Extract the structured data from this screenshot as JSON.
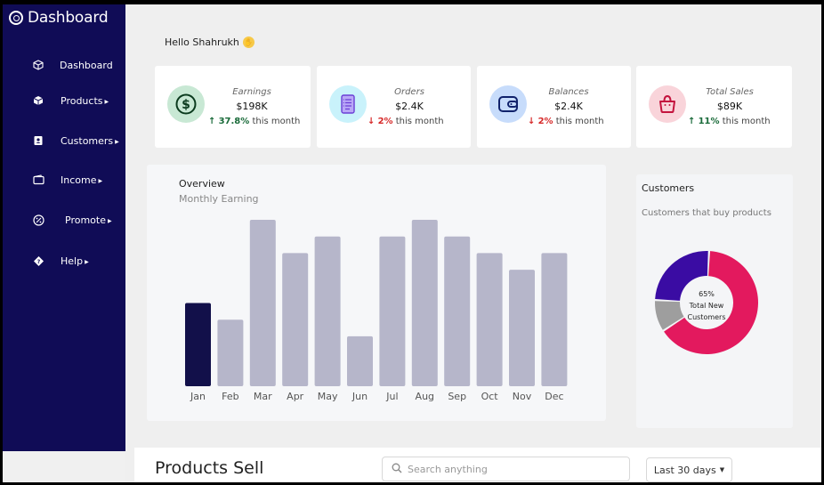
{
  "sidebar": {
    "brand": "Dashboard",
    "items": [
      {
        "label": "Dashboard",
        "icon": "cube-icon",
        "caret": false
      },
      {
        "label": "Products",
        "icon": "box-icon",
        "caret": true
      },
      {
        "label": "Customers",
        "icon": "id-card-icon",
        "caret": true
      },
      {
        "label": "Income",
        "icon": "wallet-icon",
        "caret": true
      },
      {
        "label": "Promote",
        "icon": "percent-icon",
        "caret": true
      },
      {
        "label": "Help",
        "icon": "help-diamond-icon",
        "caret": true
      }
    ]
  },
  "greeting": "Hello Shahrukh",
  "stats": [
    {
      "title": "Earnings",
      "value": "$198K",
      "change": "37.8%",
      "direction": "up",
      "suffix": "this month",
      "icon": "dollar-icon",
      "icon_bg": "#c8e8d4",
      "icon_color": "#0b5a2a"
    },
    {
      "title": "Orders",
      "value": "$2.4K",
      "change": "2%",
      "direction": "down",
      "suffix": "this month",
      "icon": "document-icon",
      "icon_bg": "#c9f2fb",
      "icon_color": "#6b3fd6"
    },
    {
      "title": "Balances",
      "value": "$2.4K",
      "change": "2%",
      "direction": "down",
      "suffix": "this month",
      "icon": "wallet-icon",
      "icon_bg": "#c7dcfb",
      "icon_color": "#10226b"
    },
    {
      "title": "Total Sales",
      "value": "$89K",
      "change": "11%",
      "direction": "up",
      "suffix": "this month",
      "icon": "shopping-bag-icon",
      "icon_bg": "#f9d4da",
      "icon_color": "#c4143e"
    }
  ],
  "overview": {
    "title": "Overview",
    "subtitle": "Monthly Earning"
  },
  "chart_data": {
    "type": "bar",
    "categories": [
      "Jan",
      "Feb",
      "Mar",
      "Apr",
      "May",
      "Jun",
      "Jul",
      "Aug",
      "Sep",
      "Oct",
      "Nov",
      "Dec"
    ],
    "values": [
      50,
      40,
      100,
      80,
      90,
      30,
      90,
      100,
      90,
      80,
      70,
      80
    ],
    "ylim": [
      0,
      100
    ],
    "highlight_index": 0,
    "colors": {
      "highlight": "#12104a",
      "bar": "#b6b6ca"
    },
    "grid": false
  },
  "customers": {
    "title": "Customers",
    "subtitle": "Customers that buy products",
    "donut_percent": "65%",
    "donut_label_1": "Total New",
    "donut_label_2": "Customers",
    "segments": [
      {
        "value": 65,
        "color": "#e3195e"
      },
      {
        "value": 10,
        "color": "#9e9e9e"
      },
      {
        "value": 25,
        "color": "#3a0ca3"
      }
    ]
  },
  "products": {
    "title": "Products Sell",
    "search_placeholder": "Search anything",
    "range": "Last 30 days"
  }
}
